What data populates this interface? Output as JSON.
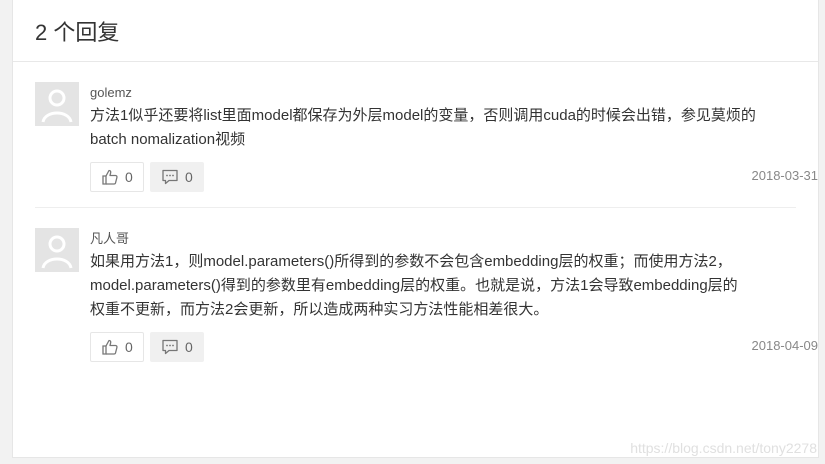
{
  "header": {
    "count_label": "2 个回复"
  },
  "comments": [
    {
      "author": "golemz",
      "text_line1": "方法1似乎还要将list里面model都保存为外层model的变量，否则调用cuda的时候会出错，参见莫烦的",
      "text_line2": "batch nomalization视频",
      "likes": "0",
      "replies": "0",
      "date": "2018-03-31"
    },
    {
      "author": "凡人哥",
      "text_line1": "如果用方法1，则model.parameters()所得到的参数不会包含embedding层的权重；而使用方法2，",
      "text_line2": "model.parameters()得到的参数里有embedding层的权重。也就是说，方法1会导致embedding层的",
      "text_line3": "权重不更新，而方法2会更新，所以造成两种实习方法性能相差很大。",
      "likes": "0",
      "replies": "0",
      "date": "2018-04-09"
    }
  ],
  "watermark": "https://blog.csdn.net/tony2278",
  "icons": {
    "avatar": "default-avatar-icon",
    "like": "thumbs-up-icon",
    "reply": "comment-icon"
  }
}
